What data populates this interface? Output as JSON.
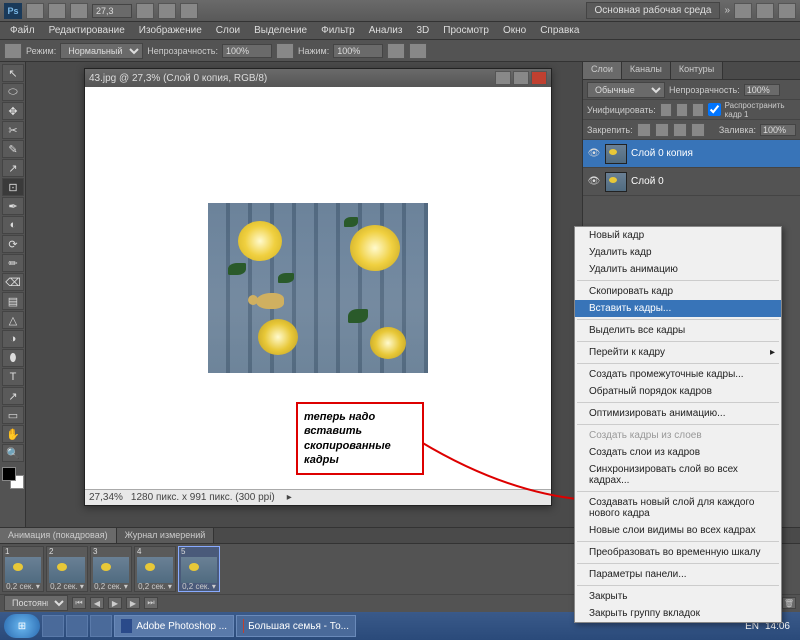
{
  "topbar": {
    "workspace_label": "Основная рабочая среда",
    "zoom_value": "27,3"
  },
  "menubar": [
    "Файл",
    "Редактирование",
    "Изображение",
    "Слои",
    "Выделение",
    "Фильтр",
    "Анализ",
    "3D",
    "Просмотр",
    "Окно",
    "Справка"
  ],
  "optbar": {
    "mode_label": "Режим:",
    "mode_value": "Нормальный",
    "opacity_label": "Непрозрачность:",
    "opacity_value": "100%",
    "flow_label": "Нажим:",
    "flow_value": "100%"
  },
  "document": {
    "title": "43.jpg @ 27,3% (Слой 0 копия, RGB/8)",
    "status_zoom": "27,34%",
    "status_dims": "1280 пикс. x 991 пикс. (300 ppi)"
  },
  "annotation": "теперь надо вставить скопированные кадры",
  "layers_panel": {
    "tabs": [
      "Слои",
      "Каналы",
      "Контуры"
    ],
    "blend_mode": "Обычные",
    "opacity_label": "Непрозрачность:",
    "opacity_value": "100%",
    "unify_label": "Унифицировать:",
    "propagate_label": "Распространить кадр 1",
    "lock_label": "Закрепить:",
    "fill_label": "Заливка:",
    "fill_value": "100%",
    "layers": [
      {
        "name": "Слой 0 копия",
        "active": true
      },
      {
        "name": "Слой 0",
        "active": false
      }
    ]
  },
  "context_menu": [
    {
      "label": "Новый кадр"
    },
    {
      "label": "Удалить кадр"
    },
    {
      "label": "Удалить анимацию"
    },
    {
      "sep": true
    },
    {
      "label": "Скопировать кадр"
    },
    {
      "label": "Вставить кадры...",
      "hover": true
    },
    {
      "sep": true
    },
    {
      "label": "Выделить все кадры"
    },
    {
      "sep": true
    },
    {
      "label": "Перейти к кадру",
      "sub": true
    },
    {
      "sep": true
    },
    {
      "label": "Создать промежуточные кадры..."
    },
    {
      "label": "Обратный порядок кадров"
    },
    {
      "sep": true
    },
    {
      "label": "Оптимизировать анимацию..."
    },
    {
      "sep": true
    },
    {
      "label": "Создать кадры из слоев",
      "dis": true
    },
    {
      "label": "Создать слои из кадров"
    },
    {
      "label": "Синхронизировать слой во всех кадрах..."
    },
    {
      "sep": true
    },
    {
      "label": "Создавать новый слой для каждого нового кадра"
    },
    {
      "label": "Новые слои видимы во всех кадрах"
    },
    {
      "sep": true
    },
    {
      "label": "Преобразовать во временную шкалу"
    },
    {
      "sep": true
    },
    {
      "label": "Параметры панели..."
    },
    {
      "sep": true
    },
    {
      "label": "Закрыть"
    },
    {
      "label": "Закрыть группу вкладок"
    }
  ],
  "animation": {
    "tabs": [
      "Анимация (покадровая)",
      "Журнал измерений"
    ],
    "frames": [
      {
        "num": "1",
        "time": "0,2 сек."
      },
      {
        "num": "2",
        "time": "0,2 сек."
      },
      {
        "num": "3",
        "time": "0,2 сек."
      },
      {
        "num": "4",
        "time": "0,2 сек."
      },
      {
        "num": "5",
        "time": "0,2 сек.",
        "sel": true
      }
    ],
    "loop_label": "Постоянно"
  },
  "taskbar": {
    "app1": "Adobe Photoshop ...",
    "app2": "Большая семья - То...",
    "lang": "EN",
    "time": "14:06"
  }
}
